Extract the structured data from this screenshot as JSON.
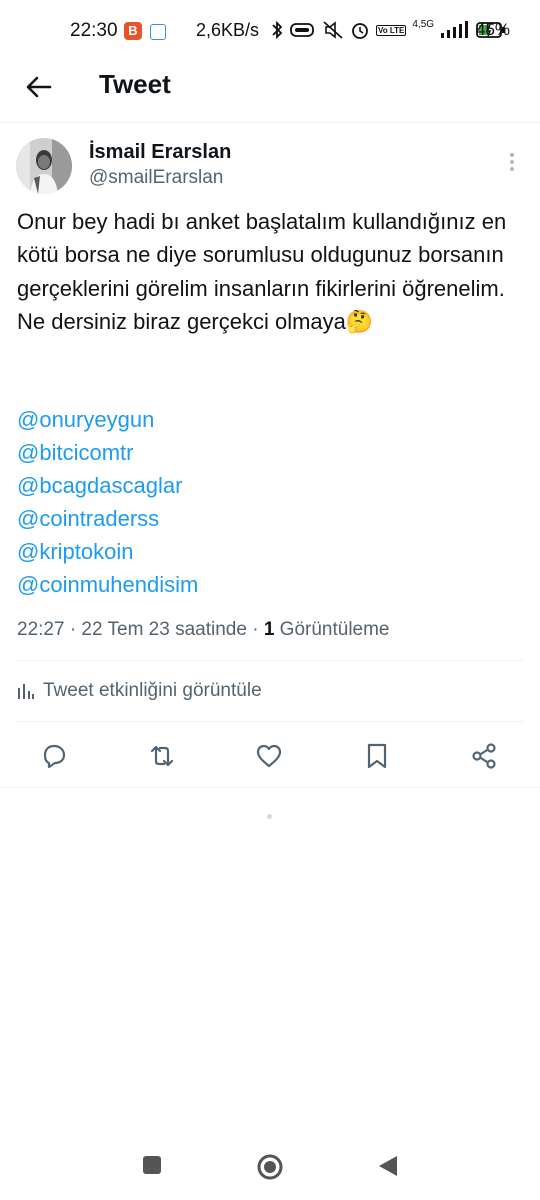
{
  "status_bar": {
    "time": "22:30",
    "b_badge": "B",
    "net_speed": "2,6KB/s",
    "network_type": "4,5G",
    "lte_label": "Vo LTE",
    "battery_percent": "45%"
  },
  "header": {
    "title": "Tweet"
  },
  "tweet": {
    "author_name": "İsmail Erarslan",
    "author_handle": "@smailErarslan",
    "text": "Onur bey hadi bı anket başlatalım kullandığınız en kötü borsa ne diye sorumlusu oldugunuz borsanın gerçeklerini görelim insanların fikirlerini öğrenelim.  Ne dersiniz biraz gerçekci olmaya🤔",
    "mentions": [
      "@onuryeygun",
      "@bitcicomtr",
      "@bcagdascaglar",
      "@cointraderss",
      "@kriptokoin",
      "@coinmuhendisim"
    ],
    "timestamp": "22:27 · 22 Tem 23 saatinde · ",
    "views_count": "1",
    "views_label": " Görüntüleme",
    "activity_label": "Tweet etkinliğini görüntüle"
  },
  "colors": {
    "link": "#1d9bf0",
    "secondary_text": "#536471",
    "primary_text": "#0f1419"
  },
  "icons": {
    "back": "arrow-left-icon",
    "more": "more-vertical-icon",
    "activity": "bar-chart-icon",
    "reply": "reply-icon",
    "retweet": "retweet-icon",
    "like": "heart-icon",
    "bookmark": "bookmark-icon",
    "share": "share-icon"
  }
}
